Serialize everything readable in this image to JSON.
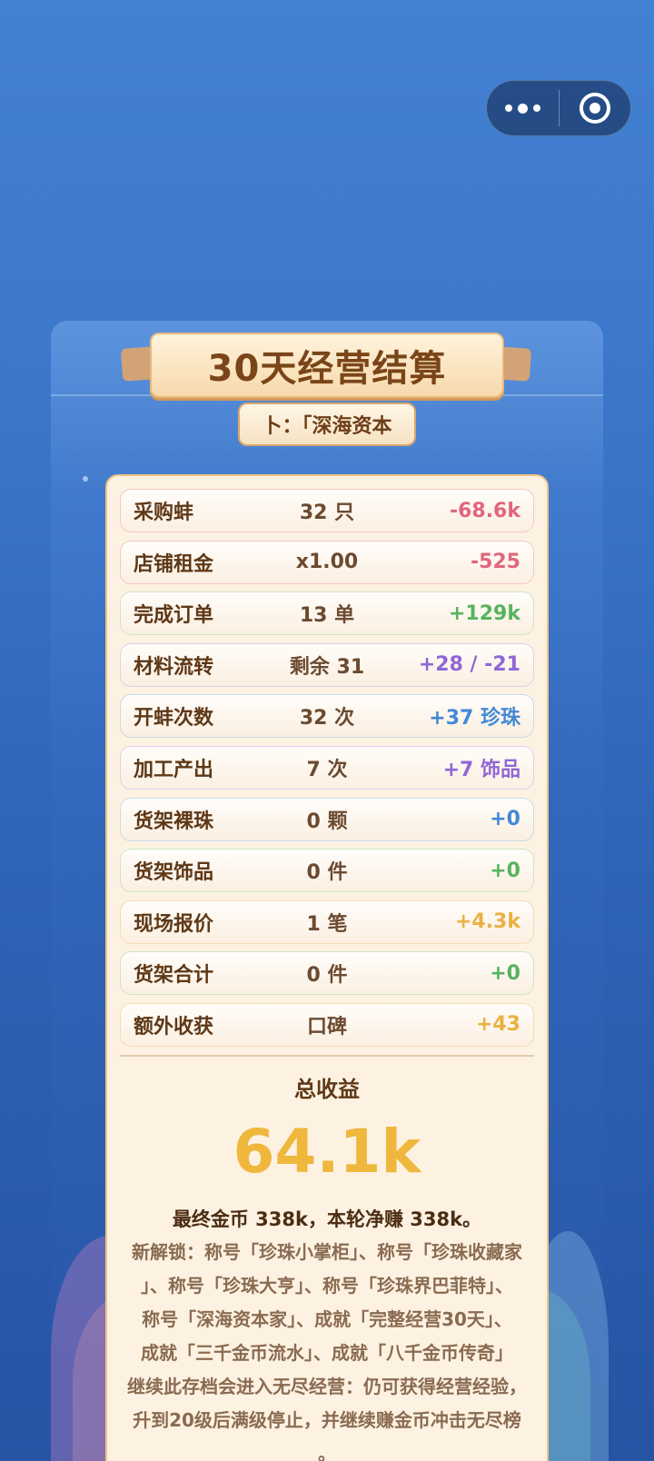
{
  "header": {
    "capsule_more_icon": "more-dots-icon",
    "capsule_close_icon": "target-circle-icon"
  },
  "settlement": {
    "title": "30天经营结算",
    "subtitle": "卜：「深海资本"
  },
  "rows": [
    {
      "label": "采购蚌",
      "mid": "32 只",
      "value": "-68.6k",
      "color": "red"
    },
    {
      "label": "店铺租金",
      "mid": "x1.00",
      "value": "-525",
      "color": "red"
    },
    {
      "label": "完成订单",
      "mid": "13 单",
      "value": "+129k",
      "color": "green"
    },
    {
      "label": "材料流转",
      "mid": "剩余 31",
      "value": "+28 / -21",
      "color": "purple"
    },
    {
      "label": "开蚌次数",
      "mid": "32 次",
      "value": "+37 珍珠",
      "color": "blue"
    },
    {
      "label": "加工产出",
      "mid": "7 次",
      "value": "+7 饰品",
      "color": "purple"
    },
    {
      "label": "货架裸珠",
      "mid": "0 颗",
      "value": "+0",
      "color": "blue"
    },
    {
      "label": "货架饰品",
      "mid": "0 件",
      "value": "+0",
      "color": "green"
    },
    {
      "label": "现场报价",
      "mid": "1 笔",
      "value": "+4.3k",
      "color": "gold"
    },
    {
      "label": "货架合计",
      "mid": "0 件",
      "value": "+0",
      "color": "green"
    },
    {
      "label": "额外收获",
      "mid": "口碑",
      "value": "+43",
      "color": "gold"
    }
  ],
  "summary": {
    "total_label": "总收益",
    "total_value": "64.1k",
    "final_line": "最终金币 338k，本轮净赚 338k。",
    "unlock_lines": [
      "新解锁：称号「珍珠小掌柜」、称号「珍珠收藏家",
      "」、称号「珍珠大亨」、称号「珍珠界巴菲特」、",
      "称号「深海资本家」、成就「完整经营30天」、",
      "成就「三千金币流水」、成就「八千金币传奇」"
    ],
    "endless_lines": [
      "继续此存档会进入无尽经营：仍可获得经营经验，",
      "升到20级后满级停止，并继续赚金币冲击无尽榜",
      "。"
    ]
  }
}
